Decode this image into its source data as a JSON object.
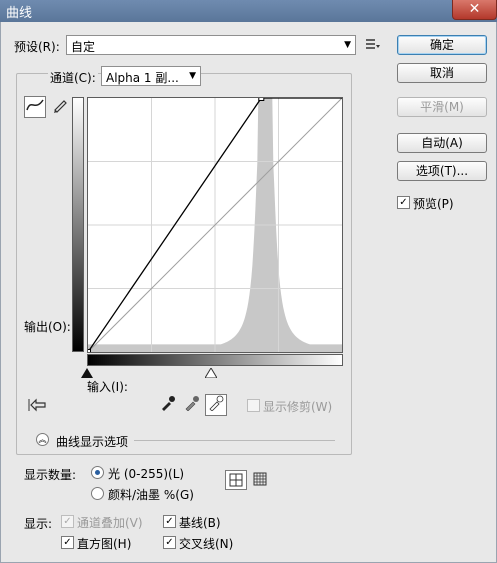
{
  "window": {
    "title": "曲线",
    "close_label": "✕"
  },
  "preset": {
    "label": "预设(R):",
    "value": "自定",
    "menu_icon": "preset-menu-icon"
  },
  "channel": {
    "label": "通道(C):",
    "value": "Alpha 1 副..."
  },
  "buttons": {
    "ok": "确定",
    "cancel": "取消",
    "smooth": "平滑(M)",
    "auto": "自动(A)",
    "options": "选项(T)..."
  },
  "preview": {
    "label": "预览(P)",
    "checked": true
  },
  "graph": {
    "output_label": "输出(O):",
    "input_label": "输入(I):",
    "curve_points": [
      [
        0,
        0
      ],
      [
        174,
        255
      ]
    ],
    "histogram_peak_level": 178
  },
  "clipping": {
    "label": "显示修剪(W)",
    "checked": false,
    "disabled": true
  },
  "display_options": {
    "section_label": "曲线显示选项",
    "amount_label": "显示数量:",
    "light_label": "光 (0-255)(L)",
    "pigment_label": "颜料/油墨 %(G)",
    "selected_amount": "light",
    "show_label": "显示:",
    "channel_overlays": {
      "label": "通道叠加(V)",
      "checked": true,
      "disabled": true
    },
    "baseline": {
      "label": "基线(B)",
      "checked": true
    },
    "histogram": {
      "label": "直方图(H)",
      "checked": true
    },
    "intersection": {
      "label": "交叉线(N)",
      "checked": true
    }
  },
  "colors": {
    "titlebar": "#6f8bb0",
    "dialog_bg": "#e8e8e8",
    "histogram": "#c8c8c8"
  }
}
